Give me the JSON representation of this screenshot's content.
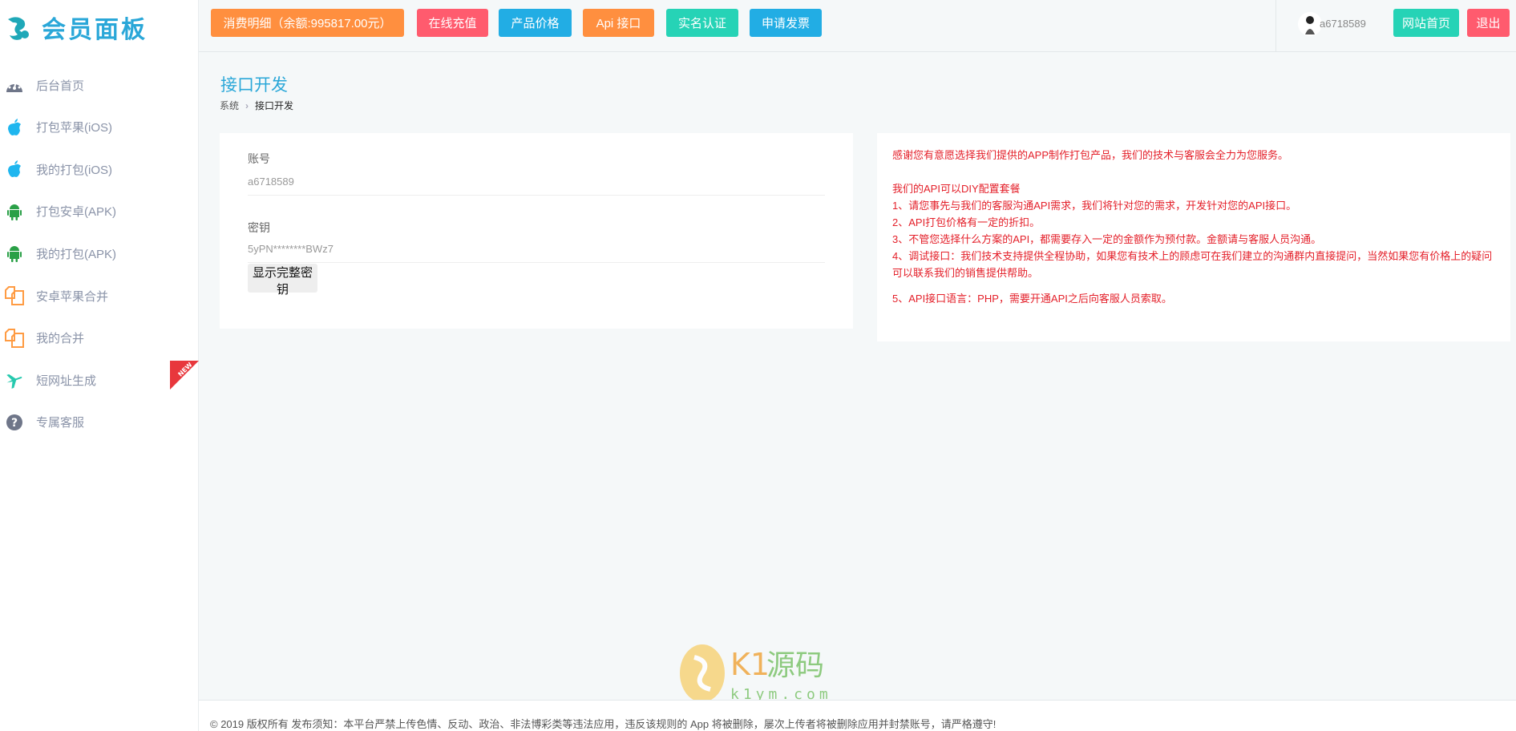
{
  "app": {
    "logo_text": "会员面板"
  },
  "sidebar": {
    "items": [
      {
        "label": "后台首页",
        "icon": "dashboard-icon"
      },
      {
        "label": "打包苹果(iOS)",
        "icon": "apple-icon"
      },
      {
        "label": "我的打包(iOS)",
        "icon": "apple-icon"
      },
      {
        "label": "打包安卓(APK)",
        "icon": "android-icon"
      },
      {
        "label": "我的打包(APK)",
        "icon": "android-icon"
      },
      {
        "label": "安卓苹果合并",
        "icon": "copy-icon"
      },
      {
        "label": "我的合并",
        "icon": "copy-icon"
      },
      {
        "label": "短网址生成",
        "icon": "plane-icon",
        "badge": "NEW"
      },
      {
        "label": "专属客服",
        "icon": "question-icon"
      }
    ]
  },
  "topbar": {
    "buttons": [
      {
        "label": "消费明细（余额:995817.00元）",
        "color": "#ff8f3f"
      },
      {
        "label": "在线充值",
        "color": "#ff5b6e"
      },
      {
        "label": "产品价格",
        "color": "#22ade4"
      },
      {
        "label": "Api 接口",
        "color": "#ff8f3f"
      },
      {
        "label": "实名认证",
        "color": "#26d3b6"
      },
      {
        "label": "申请发票",
        "color": "#22ade4"
      }
    ],
    "username": "a6718589",
    "home_label": "网站首页",
    "logout_label": "退出"
  },
  "page": {
    "title": "接口开发",
    "breadcrumb": [
      "系统",
      "接口开发"
    ]
  },
  "account": {
    "account_label": "账号",
    "account_value": "a6718589",
    "key_label": "密钥",
    "key_value": "5yPN********BWz7",
    "show_key_label": "显示完整密钥"
  },
  "info": {
    "intro": "感谢您有意愿选择我们提供的APP制作打包产品，我们的技术与客服会全力为您服务。",
    "heading": "我们的API可以DIY配置套餐",
    "lines": [
      "1、请您事先与我们的客服沟通API需求，我们将针对您的需求，开发针对您的API接口。",
      "2、API打包价格有一定的折扣。",
      "3、不管您选择什么方案的API，都需要存入一定的金额作为预付款。金额请与客服人员沟通。",
      "4、调试接口：我们技术支持提供全程协助，如果您有技术上的顾虑可在我们建立的沟通群内直接提问，当然如果您有价格上的疑问可以联系我们的销售提供帮助。"
    ],
    "last": "5、API接口语言：PHP，需要开通API之后向客服人员索取。"
  },
  "footer": {
    "text": "© 2019 版权所有 发布须知：本平台严禁上传色情、反动、政治、非法博彩类等违法应用，违反该规则的 App 将被删除，屡次上传者将被删除应用并封禁账号，请严格遵守!"
  },
  "watermark": {
    "brand": "K1源码",
    "domain": "k1ym.com"
  }
}
